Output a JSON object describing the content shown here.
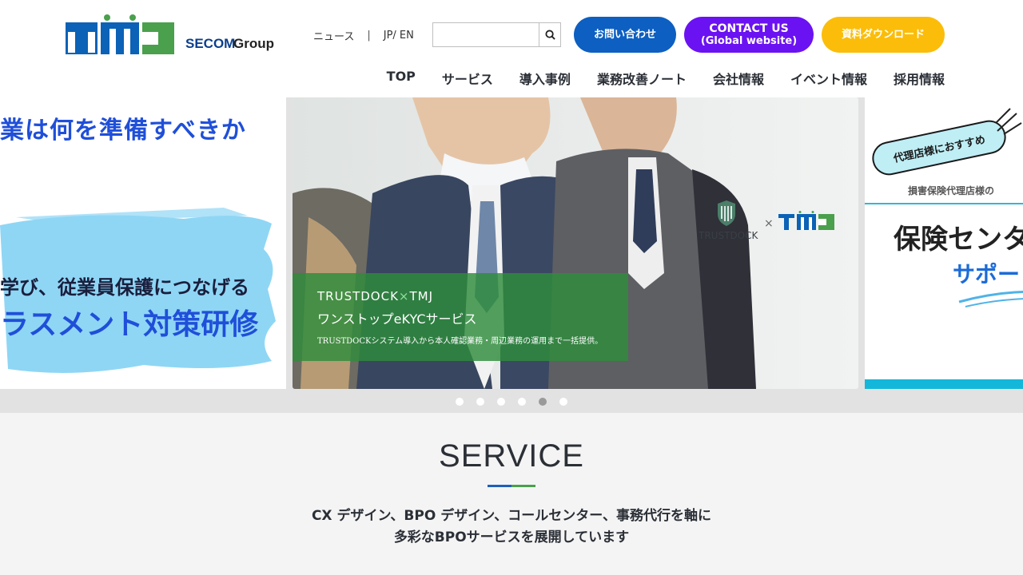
{
  "header": {
    "logo_text": "TMJ",
    "group_text": "SECOM Group",
    "util_links": {
      "news": "ニュース",
      "lang": "JP/ EN"
    },
    "search": {
      "placeholder": "",
      "value": ""
    },
    "buttons": {
      "contact_jp": "お問い合わせ",
      "contact_en_line1": "CONTACT US",
      "contact_en_line2": "(Global website)",
      "download": "資料ダウンロード"
    },
    "colors": {
      "contact_jp": "#0d5fc1",
      "contact_en": "#6b12f2",
      "download": "#fbbd09"
    }
  },
  "nav": {
    "items": [
      "TOP",
      "サービス",
      "導入事例",
      "業務改善ノート",
      "会社情報",
      "イベント情報",
      "採用情報"
    ]
  },
  "slider": {
    "left": {
      "headline": "業は何を準備すべきか",
      "line1": "学び、従業員保護につなげる",
      "line2": "ラスメント対策研修"
    },
    "center": {
      "title_a": "TRUSTDOCK",
      "title_x": "×",
      "title_b": "TMJ",
      "title_line2": "ワンストップeKYCサービス",
      "caption": "TRUSTDOCKシステム導入から本人確認業務・周辺業務の運用まで一括提供。",
      "partner_logo": "TRUSTDOCK",
      "cross": "×",
      "partner2_logo": "TMJ"
    },
    "right": {
      "badge": "代理店様におすすめ",
      "sub": "損害保険代理店様の",
      "big": "保険センタ",
      "blue": "サポート"
    },
    "dots_count": 6,
    "active_dot": 4
  },
  "service": {
    "title": "SERVICE",
    "desc_line1": "CX デザイン、BPO デザイン、コールセンター、事務代行を軸に",
    "desc_line2": "多彩なBPOサービスを展開しています"
  }
}
